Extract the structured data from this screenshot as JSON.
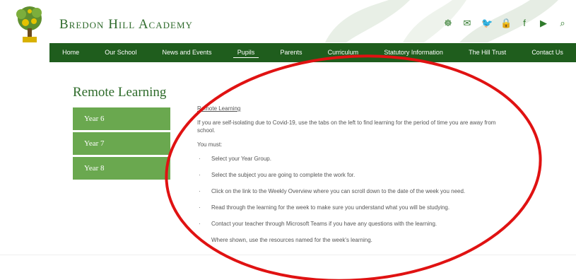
{
  "header": {
    "school_name": "Bredon Hill Academy",
    "icons": [
      {
        "name": "sign-language-icon",
        "glyph": "☸"
      },
      {
        "name": "email-icon",
        "glyph": "✉"
      },
      {
        "name": "twitter-icon",
        "glyph": "🐦"
      },
      {
        "name": "lock-icon",
        "glyph": "🔒"
      },
      {
        "name": "facebook-icon",
        "glyph": "f"
      },
      {
        "name": "youtube-icon",
        "glyph": "▶"
      },
      {
        "name": "search-icon",
        "glyph": "⌕"
      }
    ]
  },
  "nav": {
    "home": "Home",
    "our_school": "Our School",
    "news": "News and Events",
    "pupils": "Pupils",
    "parents": "Parents",
    "curriculum": "Curriculum",
    "statutory": "Statutory Information",
    "trust": "The Hill Trust",
    "contact": "Contact Us"
  },
  "page": {
    "title": "Remote Learning",
    "side": {
      "year6": "Year 6",
      "year7": "Year 7",
      "year8": "Year 8"
    },
    "content": {
      "heading": "Remote Learning",
      "intro": "If you are self-isolating due to Covid-19, use the tabs on the left to find learning for the period of time you are away from school.",
      "must": "You must:",
      "steps": [
        "Select your Year Group.",
        "Select the subject you are going to complete the work for.",
        "Click on the link to the Weekly Overview where you can scroll down to the date of the week you need.",
        "Read through the learning for the week to make sure you understand what you will be studying.",
        "Contact your teacher through Microsoft Teams if you have any questions with the learning.",
        "Where shown, use the resources named for the week's learning."
      ]
    }
  },
  "colors": {
    "nav_bg": "#1f5d1d",
    "side_bg": "#6aa84f",
    "brand_green": "#2f6b2c",
    "annotation": "#e01212"
  }
}
